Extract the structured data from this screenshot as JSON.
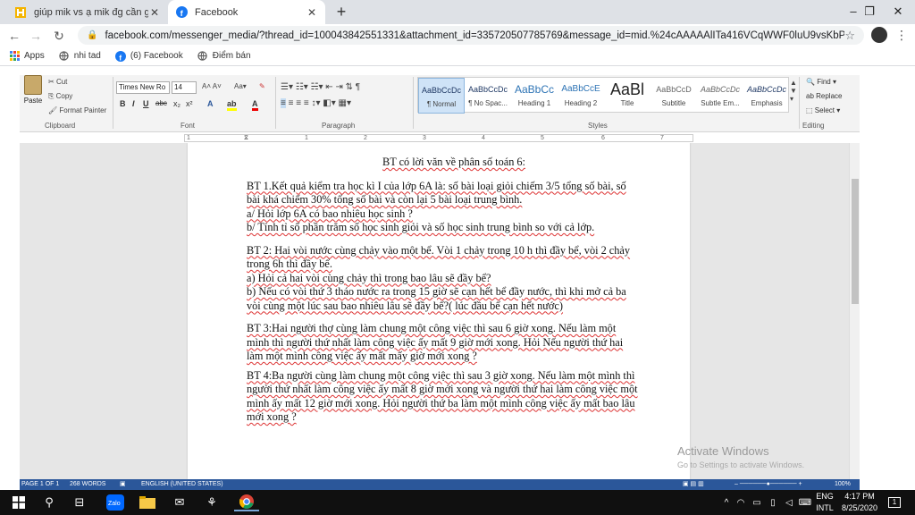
{
  "browser": {
    "tabs": [
      {
        "title": "giúp mik vs ạ mik đg cần gấp hứ",
        "icon": "hoc247-icon"
      },
      {
        "title": "Facebook",
        "icon": "facebook-icon",
        "active": true
      }
    ],
    "new_tab": "+",
    "window_controls": {
      "minimize": "–",
      "restore": "❐",
      "close": "✕"
    },
    "nav": {
      "back": "←",
      "forward": "→",
      "reload": "↻"
    },
    "url": "facebook.com/messenger_media/?thread_id=100043842551331&attachment_id=335720507785769&message_id=mid.%24cAAAAAlITa416VCqWWF0luU9vsKbP",
    "bookmarks": [
      {
        "label": "Apps",
        "icon": "apps-grid-icon"
      },
      {
        "label": "nhi tad",
        "icon": "globe-icon"
      },
      {
        "label": "(6) Facebook",
        "icon": "facebook-icon"
      },
      {
        "label": "Điểm bán",
        "icon": "globe-icon"
      }
    ]
  },
  "ribbon": {
    "clipboard": {
      "paste": "Paste",
      "cut": "Cut",
      "copy": "Copy",
      "format_painter": "Format Painter",
      "label": "Clipboard"
    },
    "font": {
      "family": "Times New Ro",
      "size": "14",
      "bold": "B",
      "italic": "I",
      "underline": "U",
      "strike": "abc",
      "subscript": "x₂",
      "superscript": "x²",
      "label": "Font"
    },
    "paragraph": {
      "label": "Paragraph"
    },
    "styles": {
      "label": "Styles",
      "items": [
        {
          "preview": "AaBbCcDc",
          "name": "¶ Normal"
        },
        {
          "preview": "AaBbCcDc",
          "name": "¶ No Spac..."
        },
        {
          "preview": "AaBbCc",
          "name": "Heading 1"
        },
        {
          "preview": "AaBbCcE",
          "name": "Heading 2"
        },
        {
          "preview": "AaBl",
          "name": "Title"
        },
        {
          "preview": "AaBbCcD",
          "name": "Subtitle"
        },
        {
          "preview": "AaBbCcDc",
          "name": "Subtle Em..."
        },
        {
          "preview": "AaBbCcDc",
          "name": "Emphasis"
        }
      ]
    },
    "editing": {
      "find": "Find",
      "replace": "Replace",
      "select": "Select",
      "label": "Editing"
    }
  },
  "ruler_ticks": [
    "1",
    "1",
    "2",
    "3",
    "4",
    "5",
    "6",
    "7"
  ],
  "document": {
    "title": "BT có lời văn về phân số toán 6:",
    "bt1": {
      "p1": "BT 1.Kết quả kiểm tra học kì I của lớp 6A là: số bài loại giỏi chiếm 3/5 tổng số bài, số bài khá chiếm 30% tổng số bài và còn lại 5 bài loại trung bình.",
      "a": "a/ Hỏi lớp 6A có bao nhiêu học sinh ?",
      "b": "b/ Tính tỉ số phần trăm số học sinh giỏi và số học sinh trung bình so với cả lớp."
    },
    "bt2": {
      "p1": "BT 2: Hai vòi nước cùng chảy vào một bể. Vòi 1 chảy trong 10 h thì đầy bể, vòi 2 chảy trong 6h thì đầy bể.",
      "a": "a) Hỏi cả hai vòi cùng chảy thì trong bao lâu sẽ đầy bể?",
      "b": "b) Nếu có vòi thứ 3 tháo nước ra trong 15 giờ sẽ cạn hết bể đầy nước, thì khi mở cả ba vòi cùng một lúc sau bao nhiêu lâu sẽ đầy bể?( lúc đầu bể cạn hết nước)"
    },
    "bt3": "BT 3:Hai người thợ cùng làm chung một công việc thì sau 6 giờ xong. Nếu làm một mình thì người thứ nhất làm công việc ấy mất 9 giờ mới xong. Hỏi Nếu người thứ hai làm một mình công việc ấy mất mấy giờ mới xong ?",
    "bt4": "BT 4:Ba người cùng làm chung một công việc thì sau 3 giờ xong. Nếu làm một mình thì người thứ nhất làm công việc ấy mất 8 giờ mới xong và người thứ hai làm công việc một mình ấy mất 12 giờ mới xong. Hỏi người thứ ba làm một mình công việc ấy mất bao lâu mới xong ?"
  },
  "watermark": {
    "line1": "Activate Windows",
    "line2": "Go to Settings to activate Windows."
  },
  "status": {
    "page": "PAGE 1 OF 1",
    "words": "268 WORDS",
    "language": "ENGLISH (UNITED STATES)",
    "zoom": "100%"
  },
  "taskbar": {
    "lang1": "ENG",
    "lang2": "INTL",
    "time": "4:17 PM",
    "date": "8/25/2020",
    "notification_count": "1"
  }
}
